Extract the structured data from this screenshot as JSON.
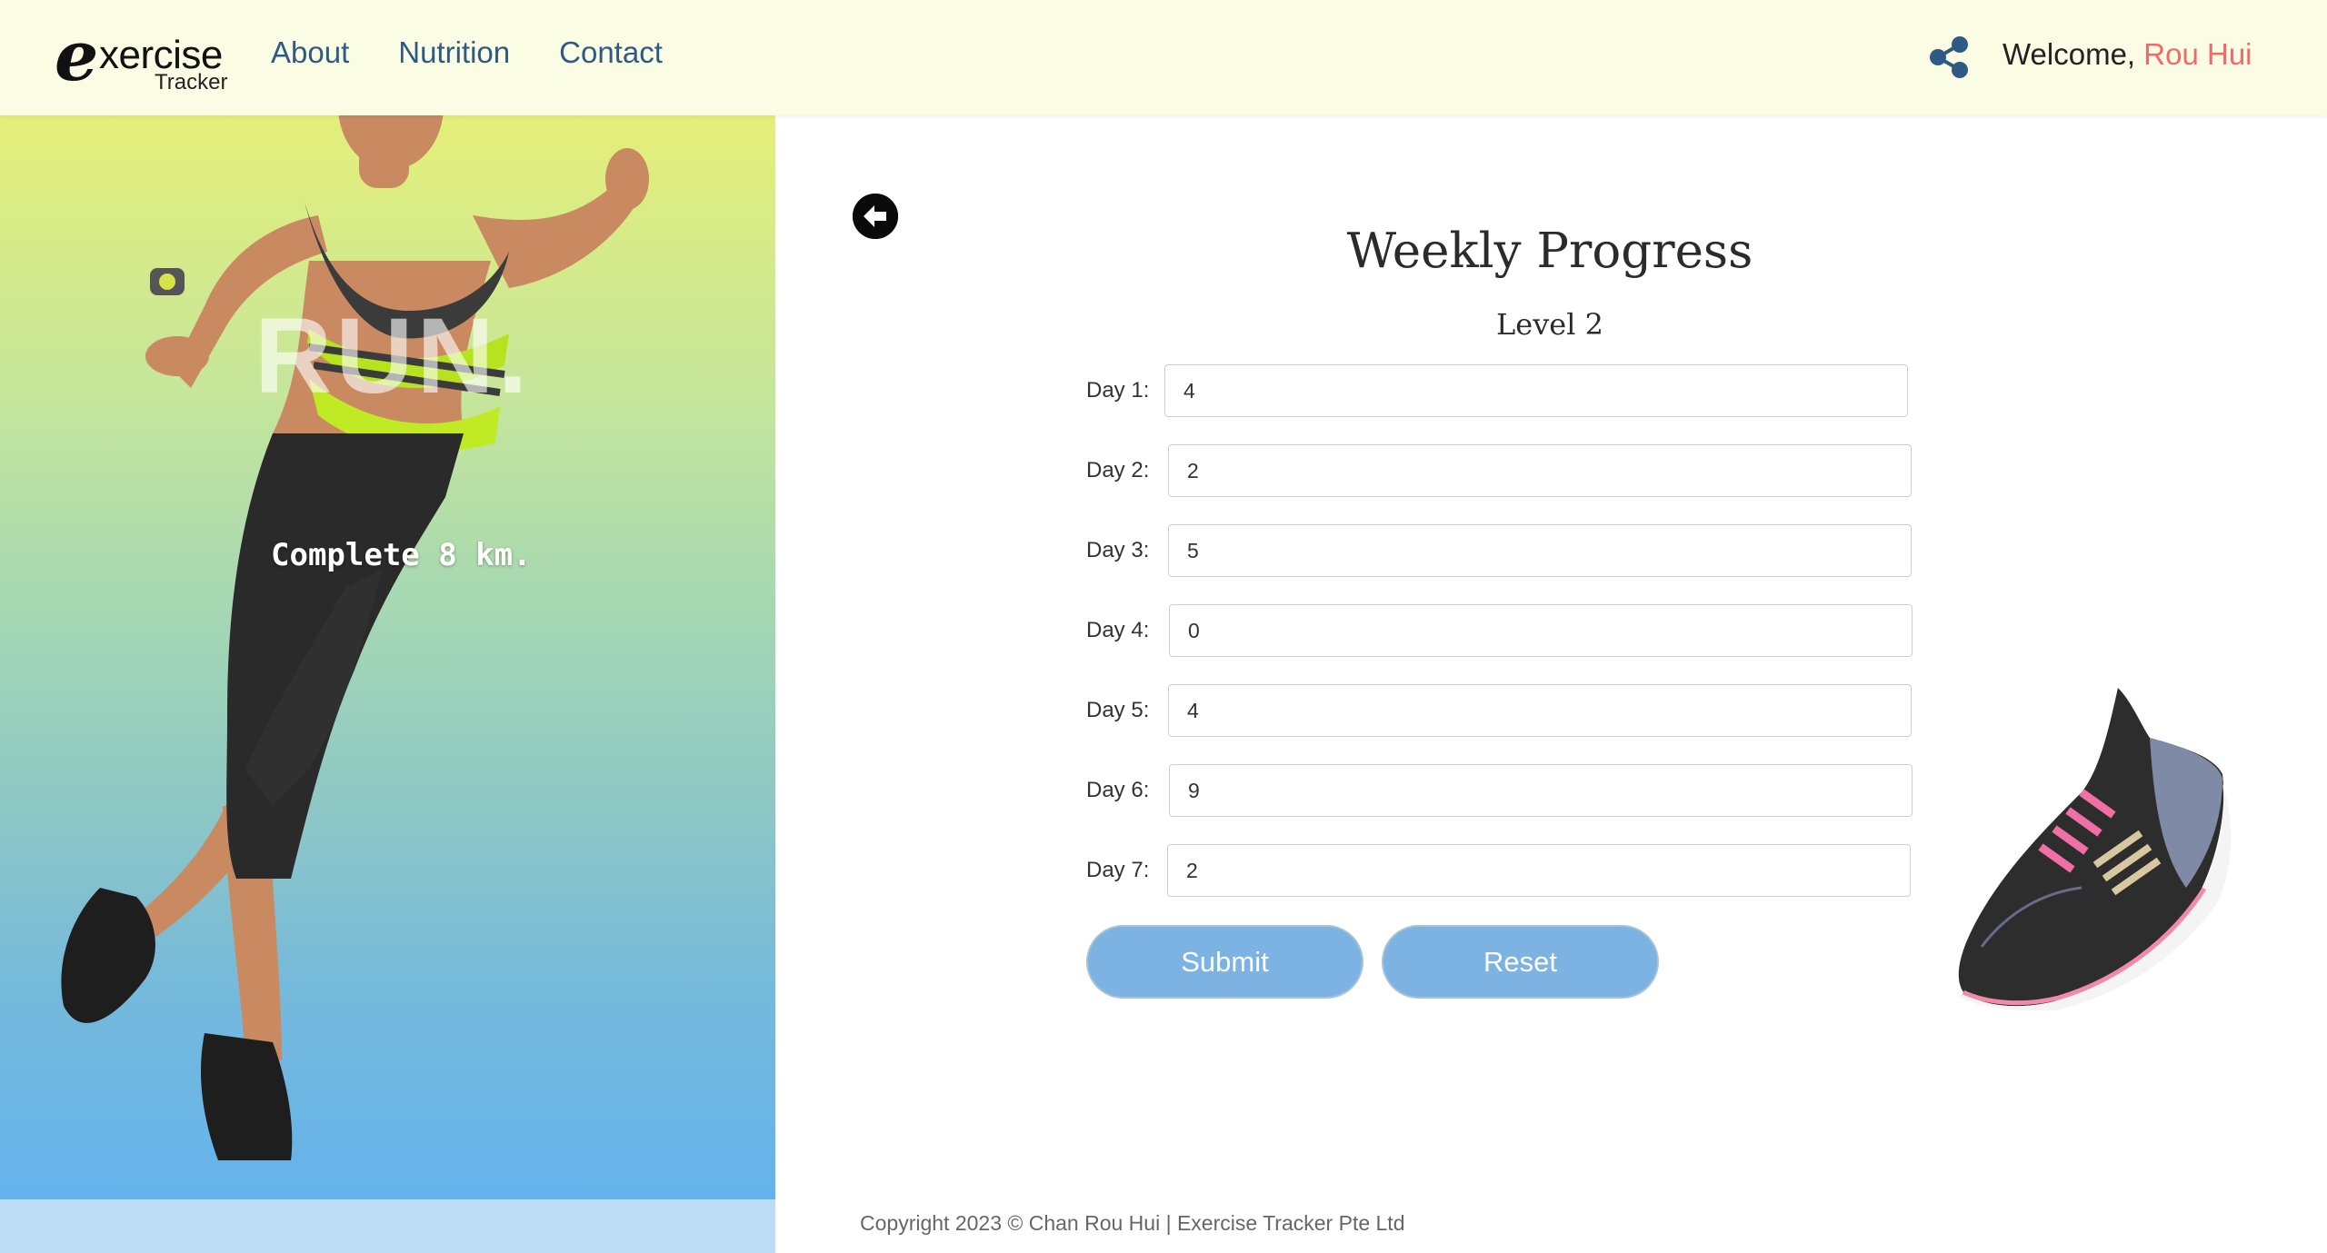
{
  "header": {
    "logo": {
      "letter": "e",
      "word": "xercise",
      "sub": "Tracker"
    },
    "nav": [
      {
        "label": "About"
      },
      {
        "label": "Nutrition"
      },
      {
        "label": "Contact"
      }
    ],
    "share_icon": "share-icon",
    "welcome_prefix": "Welcome,",
    "user_name": "Rou Hui",
    "colors": {
      "background": "#fafde3",
      "nav_link": "#2f5a86",
      "user_name": "#ef6b6b"
    }
  },
  "hero": {
    "headline": "RUN.",
    "caption": "Complete 8 km.",
    "colors": {
      "gradient_top": "#e4ef79",
      "gradient_bottom": "#65b3ec"
    }
  },
  "form": {
    "back_icon": "arrow-left-icon",
    "title": "Weekly Progress",
    "level": "Level 2",
    "days": [
      {
        "label": "Day 1:",
        "value": "4"
      },
      {
        "label": "Day 2:",
        "value": "2"
      },
      {
        "label": "Day 3:",
        "value": "5"
      },
      {
        "label": "Day 4:",
        "value": "0"
      },
      {
        "label": "Day 5:",
        "value": "4"
      },
      {
        "label": "Day 6:",
        "value": "9"
      },
      {
        "label": "Day 7:",
        "value": "2"
      }
    ],
    "submit_label": "Submit",
    "reset_label": "Reset",
    "colors": {
      "button": "#7cb3e2"
    }
  },
  "footer": {
    "copyright": "Copyright 2023 © Chan Rou Hui | Exercise Tracker Pte Ltd"
  }
}
